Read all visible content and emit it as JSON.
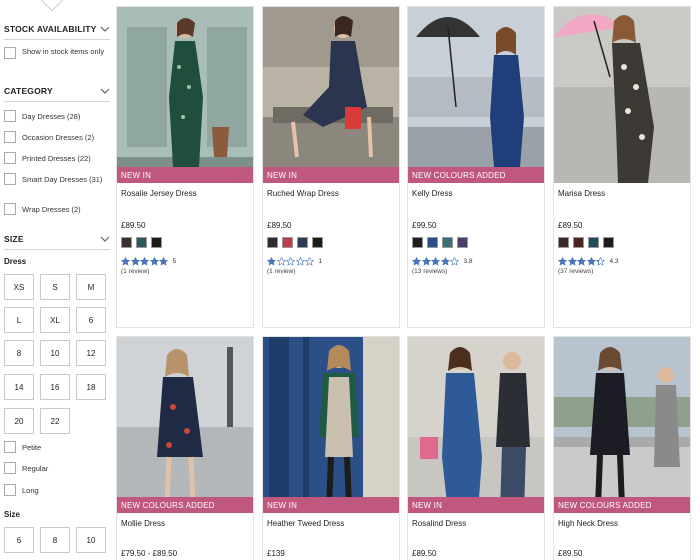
{
  "filters": {
    "stock": {
      "title": "STOCK AVAILABILITY",
      "option": "Show in stock items only"
    },
    "category": {
      "title": "CATEGORY",
      "items": [
        {
          "label": "Day Dresses (28)"
        },
        {
          "label": "Occasion Dresses (2)"
        },
        {
          "label": "Printed Dresses (22)"
        },
        {
          "label": "Smart Day Dresses (31)"
        },
        {
          "label": "Wrap Dresses (2)"
        }
      ]
    },
    "size": {
      "title": "SIZE",
      "dress_title": "Dress",
      "dress_sizes": [
        "XS",
        "S",
        "M",
        "L",
        "XL",
        "6",
        "8",
        "10",
        "12",
        "14",
        "16",
        "18",
        "20",
        "22"
      ],
      "fit_options": [
        "Petite",
        "Regular",
        "Long"
      ],
      "size_title": "Size",
      "sizes": [
        "6",
        "8",
        "10"
      ]
    }
  },
  "products": [
    {
      "name": "Rosalie Jersey Dress",
      "badge": "NEW IN",
      "price": "£89.50",
      "swatches": [
        "#3b2f2f",
        "#2b5a5e",
        "#1c1c1c"
      ],
      "rating": 5,
      "rating_label": "5",
      "reviews": "(1 review)",
      "photo": {
        "bg": "#9db3ad",
        "dress": "#1f4f3c",
        "accent": "#8c5a3c"
      }
    },
    {
      "name": "Ruched Wrap Dress",
      "badge": "NEW IN",
      "price": "£89.50",
      "swatches": [
        "#2c2c2c",
        "#c23b4a",
        "#2e3b55",
        "#1c1c1c"
      ],
      "rating": 1,
      "rating_label": "1",
      "reviews": "(1 review)",
      "photo": {
        "bg": "#b9b3a6",
        "dress": "#2b3550",
        "accent": "#d93a3a"
      }
    },
    {
      "name": "Kelly Dress",
      "badge": "NEW COLOURS ADDED",
      "price": "£99.50",
      "swatches": [
        "#1e1e1e",
        "#2a4f8a",
        "#3a6e7a",
        "#4b3d6e"
      ],
      "rating": 3.8,
      "rating_label": "3.8",
      "reviews": "(13 reviews)",
      "photo": {
        "bg": "#c9cfd6",
        "dress": "#1f3f7a",
        "accent": "#333333"
      }
    },
    {
      "name": "Marisa Dress",
      "badge": "",
      "price": "£89.50",
      "swatches": [
        "#3a2a2a",
        "#4a2420",
        "#1f4f5a",
        "#1c1c1c"
      ],
      "rating": 4.3,
      "rating_label": "4.3",
      "reviews": "(37 reviews)",
      "photo": {
        "bg": "#b7b7b4",
        "dress": "#3d3a36",
        "accent": "#f2a7c4"
      }
    },
    {
      "name": "Mollie Dress",
      "badge": "NEW COLOURS ADDED",
      "price": "£79.50 - £89.50",
      "swatches": [],
      "rating": 0,
      "rating_label": "",
      "reviews": "",
      "photo": {
        "bg": "#cfd3d6",
        "dress": "#1f2a44",
        "accent": "#c8463a"
      }
    },
    {
      "name": "Heather Tweed Dress",
      "badge": "NEW IN",
      "price": "£139",
      "swatches": [],
      "rating": 0,
      "rating_label": "",
      "reviews": "",
      "photo": {
        "bg": "#2b4f86",
        "dress": "#c9c0b0",
        "accent": "#1e5a44"
      }
    },
    {
      "name": "Rosalind Dress",
      "badge": "NEW IN",
      "price": "£89.50",
      "swatches": [],
      "rating": 0,
      "rating_label": "",
      "reviews": "",
      "photo": {
        "bg": "#c8c6c0",
        "dress": "#2e5a9a",
        "accent": "#e06a8f"
      }
    },
    {
      "name": "High Neck Dress",
      "badge": "NEW COLOURS ADDED",
      "price": "£89.50",
      "swatches": [],
      "rating": 0,
      "rating_label": "",
      "reviews": "",
      "photo": {
        "bg": "#b7c3cf",
        "dress": "#1c1c24",
        "accent": "#8a8a8a"
      }
    }
  ]
}
